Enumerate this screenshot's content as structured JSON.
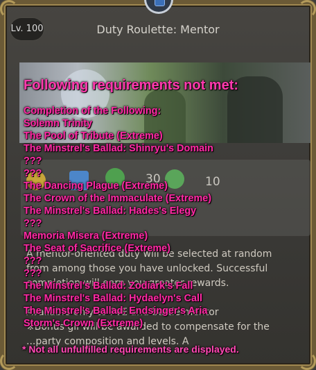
{
  "window": {
    "level_badge": "Lv. 100",
    "title": "Duty Roulette: Mentor"
  },
  "rewards": {
    "values": [
      "30",
      "10"
    ]
  },
  "description": {
    "lines": [
      "A mentor-oriented duty will be selected at random",
      "from among those you have unlocked. Successful",
      "completion will earn you greater rewards.",
      "",
      "Available only to PvE and battle mentor",
      "※Bonus gil will be awarded to compensate for the",
      "...party composition and levels. A"
    ]
  },
  "tooltip": {
    "header": "Following requirements not met:",
    "lines": [
      "Completion of the Following:",
      "Solemn Trinity",
      "The Pool of Tribute (Extreme)",
      "The Minstrel's Ballad: Shinryu's Domain",
      "???",
      "???",
      "The Dancing Plague (Extreme)",
      "The Crown of the Immaculate (Extreme)",
      "The Minstrel's Ballad: Hades's Elegy",
      "???",
      "Memoria Misera (Extreme)",
      "The Seat of Sacrifice (Extreme)",
      "???",
      "???",
      "The Minstrel's Ballad: Zodiark's Fall",
      "The Minstrel's Ballad: Hydaelyn's Call",
      "The Minstrel's Ballad: Endsinger's Aria",
      "Storm's Crown (Extreme)"
    ],
    "footnote": "* Not all unfulfilled requirements are displayed."
  },
  "colors": {
    "tooltip_text": "#ff2aa5",
    "frame_gold": "#b39a5a"
  }
}
